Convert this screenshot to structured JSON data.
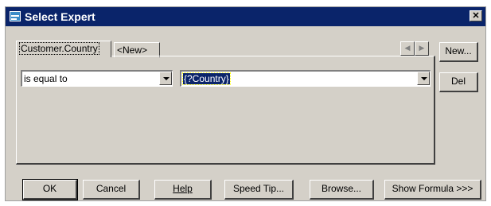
{
  "window": {
    "title": "Select Expert",
    "close_glyph": "✕"
  },
  "tabs": [
    {
      "label": "Customer.Country",
      "active": true
    },
    {
      "label": "<New>",
      "active": false
    }
  ],
  "side_buttons": {
    "new_label": "New...",
    "del_label": "Del"
  },
  "criteria": {
    "operator": "is equal to",
    "value": "{?Country}"
  },
  "nav": {
    "prev_icon": "arrow-left-icon",
    "next_icon": "arrow-right-icon"
  },
  "footer": {
    "ok": "OK",
    "cancel": "Cancel",
    "help": "Help",
    "speed_tip": "Speed Tip...",
    "browse": "Browse...",
    "show_formula": "Show Formula >>>"
  }
}
